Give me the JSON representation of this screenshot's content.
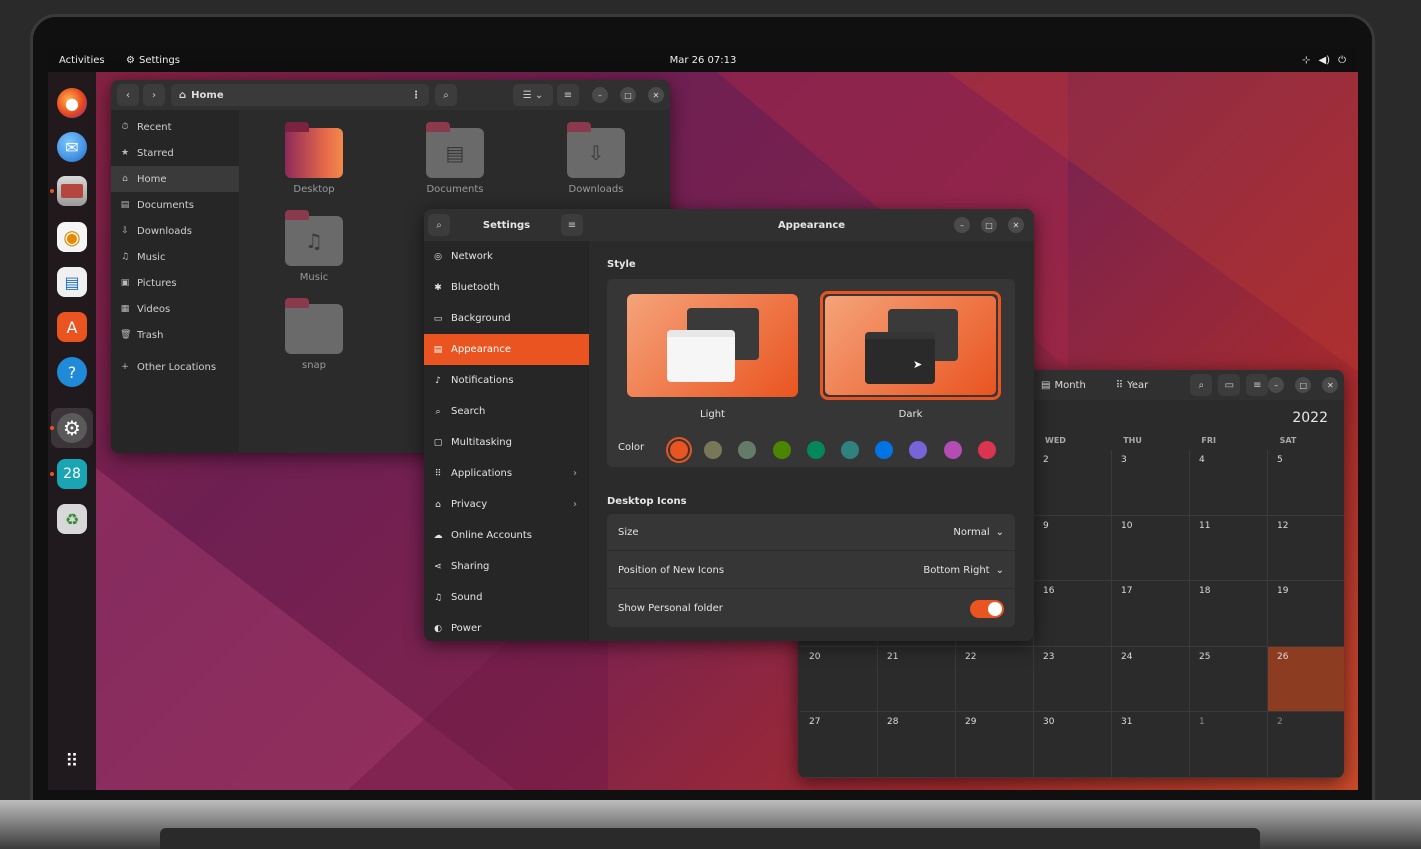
{
  "topbar": {
    "activities": "Activities",
    "app_name": "Settings",
    "clock": "Mar 26 07:13"
  },
  "dock": {
    "calendar_day": "28"
  },
  "files": {
    "location": "Home",
    "sidebar": [
      {
        "label": "Recent",
        "icon": "⏱"
      },
      {
        "label": "Starred",
        "icon": "★"
      },
      {
        "label": "Home",
        "icon": "⌂"
      },
      {
        "label": "Documents",
        "icon": "▤"
      },
      {
        "label": "Downloads",
        "icon": "⇩"
      },
      {
        "label": "Music",
        "icon": "♫"
      },
      {
        "label": "Pictures",
        "icon": "▣"
      },
      {
        "label": "Videos",
        "icon": "▦"
      },
      {
        "label": "Trash",
        "icon": "🗑"
      }
    ],
    "other_locations": "Other Locations",
    "folders": [
      "Desktop",
      "Documents",
      "Downloads",
      "Music",
      "snap"
    ]
  },
  "settings": {
    "title": "Settings",
    "panel_title": "Appearance",
    "sidebar": [
      {
        "label": "Network",
        "icon": "◎",
        "chevron": ""
      },
      {
        "label": "Bluetooth",
        "icon": "✱",
        "chevron": ""
      },
      {
        "label": "Background",
        "icon": "▭",
        "chevron": ""
      },
      {
        "label": "Appearance",
        "icon": "▤",
        "chevron": ""
      },
      {
        "label": "Notifications",
        "icon": "♪",
        "chevron": ""
      },
      {
        "label": "Search",
        "icon": "⌕",
        "chevron": ""
      },
      {
        "label": "Multitasking",
        "icon": "▢",
        "chevron": ""
      },
      {
        "label": "Applications",
        "icon": "⠿",
        "chevron": "›"
      },
      {
        "label": "Privacy",
        "icon": "⌂",
        "chevron": "›"
      },
      {
        "label": "Online Accounts",
        "icon": "☁",
        "chevron": ""
      },
      {
        "label": "Sharing",
        "icon": "⋖",
        "chevron": ""
      },
      {
        "label": "Sound",
        "icon": "♫",
        "chevron": ""
      },
      {
        "label": "Power",
        "icon": "◐",
        "chevron": ""
      }
    ],
    "style_label": "Style",
    "light_label": "Light",
    "dark_label": "Dark",
    "color_label": "Color",
    "colors": [
      "#e95420",
      "#787859",
      "#657b69",
      "#4b8501",
      "#03875b",
      "#308280",
      "#0073e5",
      "#7764d8",
      "#b34cb3",
      "#da3450"
    ],
    "desktop_icons_label": "Desktop Icons",
    "size_label": "Size",
    "size_value": "Normal",
    "position_label": "Position of New Icons",
    "position_value": "Bottom Right",
    "personal_folder_label": "Show Personal folder"
  },
  "calendar": {
    "month_label": "Month",
    "year_label": "Year",
    "year": "2022",
    "days": [
      "WED",
      "THU",
      "FRI",
      "SAT"
    ],
    "rows": [
      [
        "",
        "",
        "",
        "",
        "2",
        "3",
        "4",
        "5"
      ],
      [
        "",
        "",
        "",
        "",
        "9",
        "10",
        "11",
        "12"
      ],
      [
        "",
        "",
        "",
        "",
        "16",
        "17",
        "18",
        "19"
      ],
      [
        "20",
        "21",
        "22",
        "",
        "23",
        "24",
        "25",
        "26"
      ],
      [
        "27",
        "28",
        "29",
        "",
        "30",
        "31",
        "1",
        "2"
      ]
    ]
  }
}
